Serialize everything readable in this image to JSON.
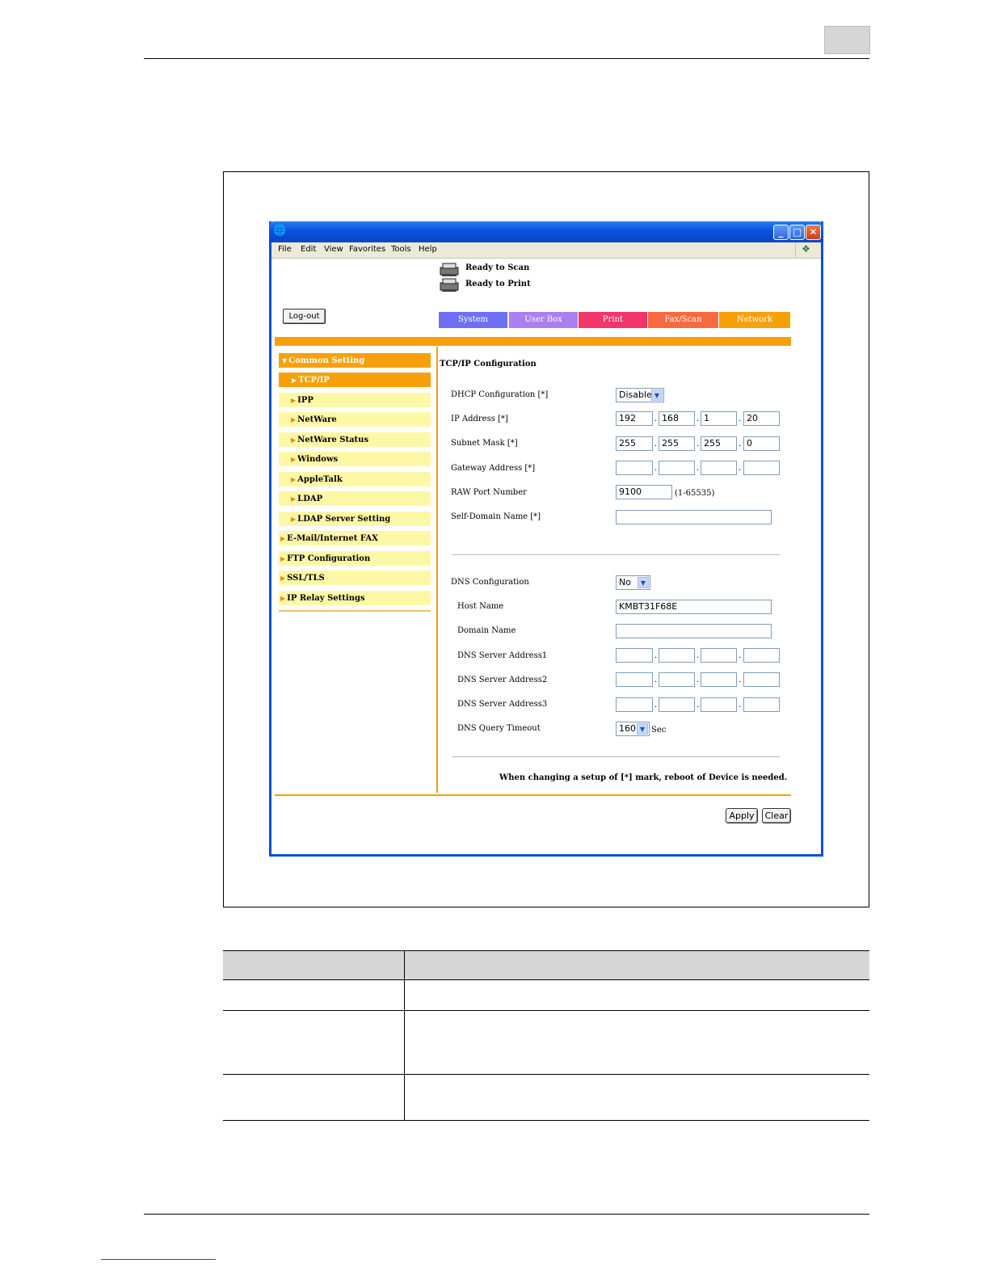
{
  "window": {
    "menu": [
      "File",
      "Edit",
      "View",
      "Favorites",
      "Tools",
      "Help"
    ]
  },
  "status": {
    "scan": "Ready to Scan",
    "print": "Ready to Print"
  },
  "logout_label": "Log-out",
  "tabs": [
    {
      "label": "System",
      "color": "#6f6ff5"
    },
    {
      "label": "User Box",
      "color": "#a97ff2"
    },
    {
      "label": "Print",
      "color": "#f2356b"
    },
    {
      "label": "Fax/Scan",
      "color": "#f76a3e"
    },
    {
      "label": "Network",
      "color": "#f7a10a"
    }
  ],
  "sidebar": {
    "items": [
      {
        "label": "Common Setting",
        "icon": "triangle-down"
      },
      {
        "label": "TCP/IP",
        "icon": "triangle-right"
      },
      {
        "label": "IPP",
        "icon": "triangle-right"
      },
      {
        "label": "NetWare",
        "icon": "triangle-right"
      },
      {
        "label": "NetWare Status",
        "icon": "triangle-right"
      },
      {
        "label": "Windows",
        "icon": "triangle-right"
      },
      {
        "label": "AppleTalk",
        "icon": "triangle-right"
      },
      {
        "label": "LDAP",
        "icon": "triangle-right"
      },
      {
        "label": "LDAP Server Setting",
        "icon": "triangle-right"
      },
      {
        "label": "E-Mail/Internet FAX",
        "icon": "triangle-right"
      },
      {
        "label": "FTP Configuration",
        "icon": "triangle-right"
      },
      {
        "label": "SSL/TLS",
        "icon": "triangle-right"
      },
      {
        "label": "IP Relay Settings",
        "icon": "triangle-right"
      }
    ]
  },
  "form": {
    "title": "TCP/IP Configuration",
    "dhcp_label": "DHCP Configuration [*]",
    "dhcp_value": "Disable",
    "ip_label": "IP Address [*]",
    "ip": [
      "192",
      "168",
      "1",
      "20"
    ],
    "subnet_label": "Subnet Mask [*]",
    "subnet": [
      "255",
      "255",
      "255",
      "0"
    ],
    "gateway_label": "Gateway Address [*]",
    "gateway": [
      "",
      "",
      "",
      ""
    ],
    "raw_port_label": "RAW Port Number",
    "raw_port_value": "9100",
    "raw_port_hint": "(1-65535)",
    "self_domain_label": "Self-Domain Name [*]",
    "self_domain_value": "",
    "dns_config_label": "DNS Configuration",
    "dns_config_value": "No",
    "host_name_label": "Host Name",
    "host_name_value": "KMBT31F68E",
    "domain_name_label": "Domain Name",
    "domain_name_value": "",
    "dns1_label": "DNS Server Address1",
    "dns2_label": "DNS Server Address2",
    "dns3_label": "DNS Server Address3",
    "dns_timeout_label": "DNS Query Timeout",
    "dns_timeout_value": "160",
    "dns_timeout_unit": "Sec",
    "note": "When changing a setup of [*] mark, reboot of Device is needed.",
    "apply_label": "Apply",
    "clear_label": "Clear"
  }
}
